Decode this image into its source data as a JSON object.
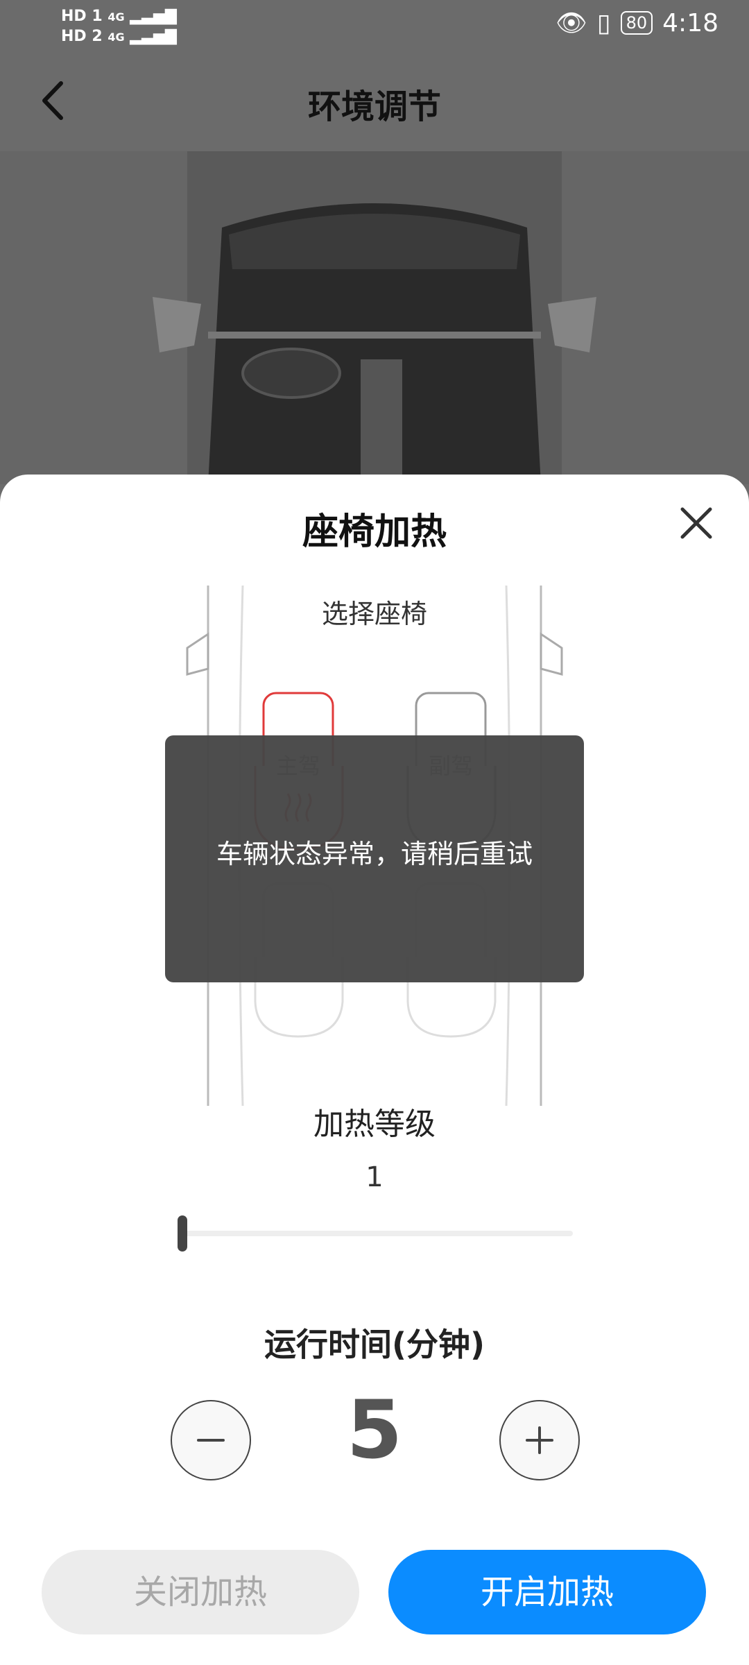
{
  "status_bar": {
    "sim1": "HD 1",
    "sim2": "HD 2",
    "network1": "4G",
    "network2": "4G",
    "battery": "80",
    "time": "4:18",
    "icons": [
      "eye-icon",
      "vibrate-icon",
      "battery-icon"
    ]
  },
  "header": {
    "title": "环境调节",
    "back_icon": "chevron-left-icon"
  },
  "sheet": {
    "title": "座椅加热",
    "close_icon": "close-icon",
    "select_label": "选择座椅",
    "seats": {
      "driver": "主驾",
      "passenger": "副驾"
    },
    "toast": "车辆状态异常，请稍后重试",
    "heat_level_label": "加热等级",
    "heat_level_value": "1",
    "heat_level_fraction": 0,
    "runtime_label": "运行时间(分钟)",
    "runtime_value": "5",
    "btn_off": "关闭加热",
    "btn_on": "开启加热"
  },
  "colors": {
    "accent": "#0b8cff",
    "selected_seat": "#e03a3a",
    "overlay": "#464646"
  }
}
